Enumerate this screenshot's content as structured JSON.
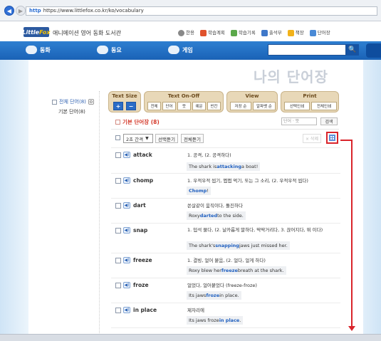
{
  "browser": {
    "url_prefix": "http",
    "url": "https://www.littlefox.co.kr/ko/vocabulary",
    "back_glyph": "◀",
    "forward_glyph": "▶"
  },
  "site": {
    "logo_a": "Little",
    "logo_b": "Fox",
    "subtitle": "애니메이션 영어 동화 도서관",
    "top_links": [
      "한용",
      "학습계획",
      "학습기록",
      "출석부",
      "책장",
      "단어장"
    ]
  },
  "nav": {
    "items": [
      "동화",
      "동요",
      "게임"
    ],
    "search_glyph": "🔍"
  },
  "page": {
    "title": "나의 단어장"
  },
  "left_panel": {
    "all_words": "전체 단어(8)",
    "gear": "⚙",
    "basic_words": "기본 단어(8)"
  },
  "toolbar": {
    "text_size": {
      "title": "Text Size",
      "plus": "+",
      "minus": "−"
    },
    "text_onoff": {
      "title": "Text On-Off",
      "buttons": [
        "전체",
        "단어",
        "뜻",
        "예문",
        "빈칸"
      ]
    },
    "view": {
      "title": "View",
      "buttons": [
        "저장 순",
        "알파벳 순"
      ]
    },
    "print": {
      "title": "Print",
      "buttons": [
        "선택인쇄",
        "전체인쇄"
      ]
    }
  },
  "vocab": {
    "header": "기본 단어장 (8)",
    "search_placeholder": "단어 · 뜻",
    "search_button": "검색",
    "interval": "2초 간격",
    "play_selected": "선택듣기",
    "play_all": "전체듣기",
    "delete": "× 삭제"
  },
  "words": [
    {
      "word": "attack",
      "def": "1. 공격, (2. 공격하다)",
      "ex_pre": "The shark is ",
      "ex_hl": "attacking",
      "ex_post": " a boat!"
    },
    {
      "word": "chomp",
      "def": "1. 우적우적 씹기, 쩝쩝 먹기, 또는 그 소리, (2. 우적우적 씹다)",
      "ex_pre": "",
      "ex_hl": "Chomp",
      "ex_post": "!"
    },
    {
      "word": "dart",
      "def": "쏜살같이 움직이다, 돌진하다",
      "ex_pre": "Roxy ",
      "ex_hl": "darted",
      "ex_post": " to the side."
    },
    {
      "word": "snap",
      "def": "1. 덥석 물다, (2. 날카롭게 말하다, 딱딱거리다, 3. 끊어지다, 뛰 이다)",
      "ex_pre": "The shark's ",
      "ex_hl": "snapping",
      "ex_post": " jaws just missed her."
    },
    {
      "word": "freeze",
      "def": "1. 결빙, 얼어 붙음, (2. 얼다, 얼게 하다)",
      "ex_pre": "Roxy blew her ",
      "ex_hl": "freeze",
      "ex_post": " breath at the shark."
    },
    {
      "word": "froze",
      "def": "얼었다, 얼어붙었다 (freeze-froze)",
      "ex_pre": "Its jaws ",
      "ex_hl": "froze",
      "ex_post": " in place."
    },
    {
      "word": "in place",
      "def": "제자리에",
      "ex_pre": "Its jaws froze ",
      "ex_hl": "in place",
      "ex_post": "."
    }
  ],
  "speaker_glyph": "◀)"
}
